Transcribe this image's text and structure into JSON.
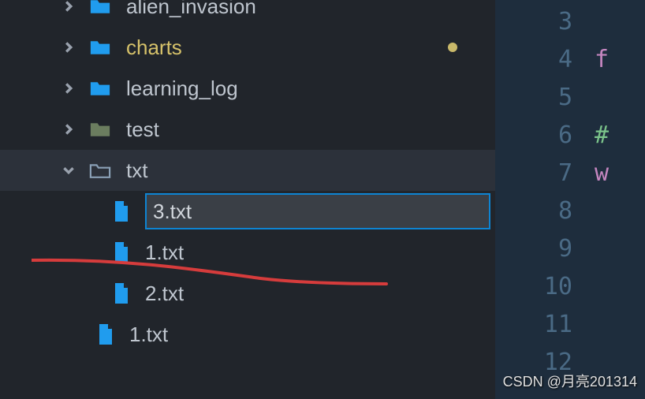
{
  "tree": {
    "row0": {
      "label": ""
    },
    "row1": {
      "label": "alien_invasion"
    },
    "row2": {
      "label": "charts"
    },
    "row3": {
      "label": "learning_log"
    },
    "row4": {
      "label": "test"
    },
    "row5": {
      "label": "txt"
    },
    "file_rename_value": "3.txt",
    "file_1": "1.txt",
    "file_2": "2.txt",
    "file_outer_1": "1.txt"
  },
  "editor": {
    "lines": [
      "3",
      "4",
      "5",
      "6",
      "7",
      "8",
      "9",
      "10",
      "11",
      "12"
    ],
    "tokens": {
      "l4": "f",
      "l6": "#",
      "l7": "w"
    }
  },
  "watermark": "CSDN @月亮201314"
}
